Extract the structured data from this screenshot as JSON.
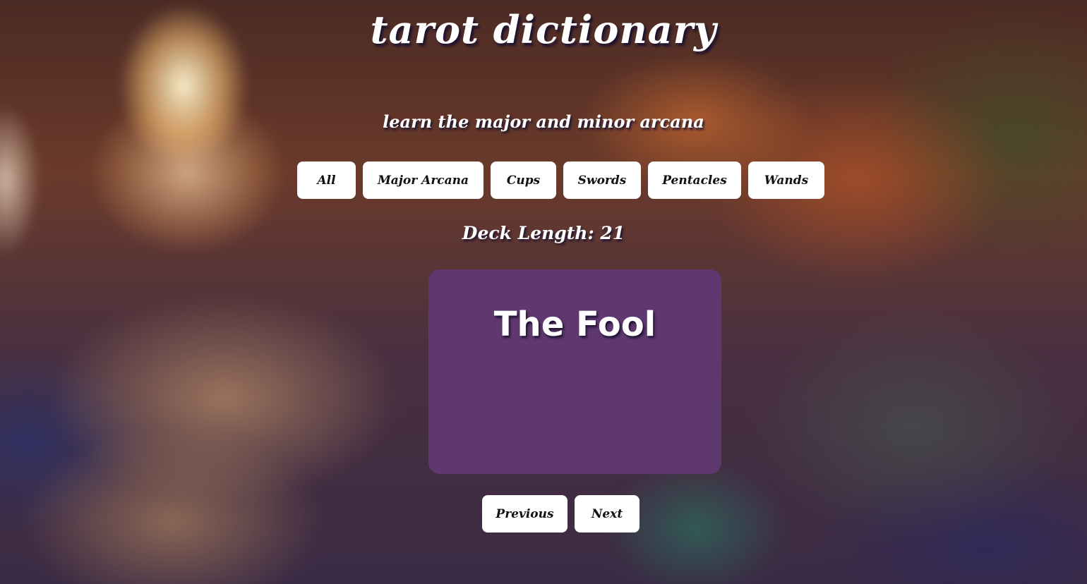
{
  "header": {
    "title": "tarot dictionary",
    "subtitle": "learn the major and minor arcana"
  },
  "filters": [
    {
      "label": "All"
    },
    {
      "label": "Major Arcana"
    },
    {
      "label": "Cups"
    },
    {
      "label": "Swords"
    },
    {
      "label": "Pentacles"
    },
    {
      "label": "Wands"
    }
  ],
  "deck": {
    "length_text": "Deck Length: 21"
  },
  "card": {
    "name": "The Fool",
    "color": "#5e386f"
  },
  "navigation": {
    "previous_label": "Previous",
    "next_label": "Next"
  }
}
